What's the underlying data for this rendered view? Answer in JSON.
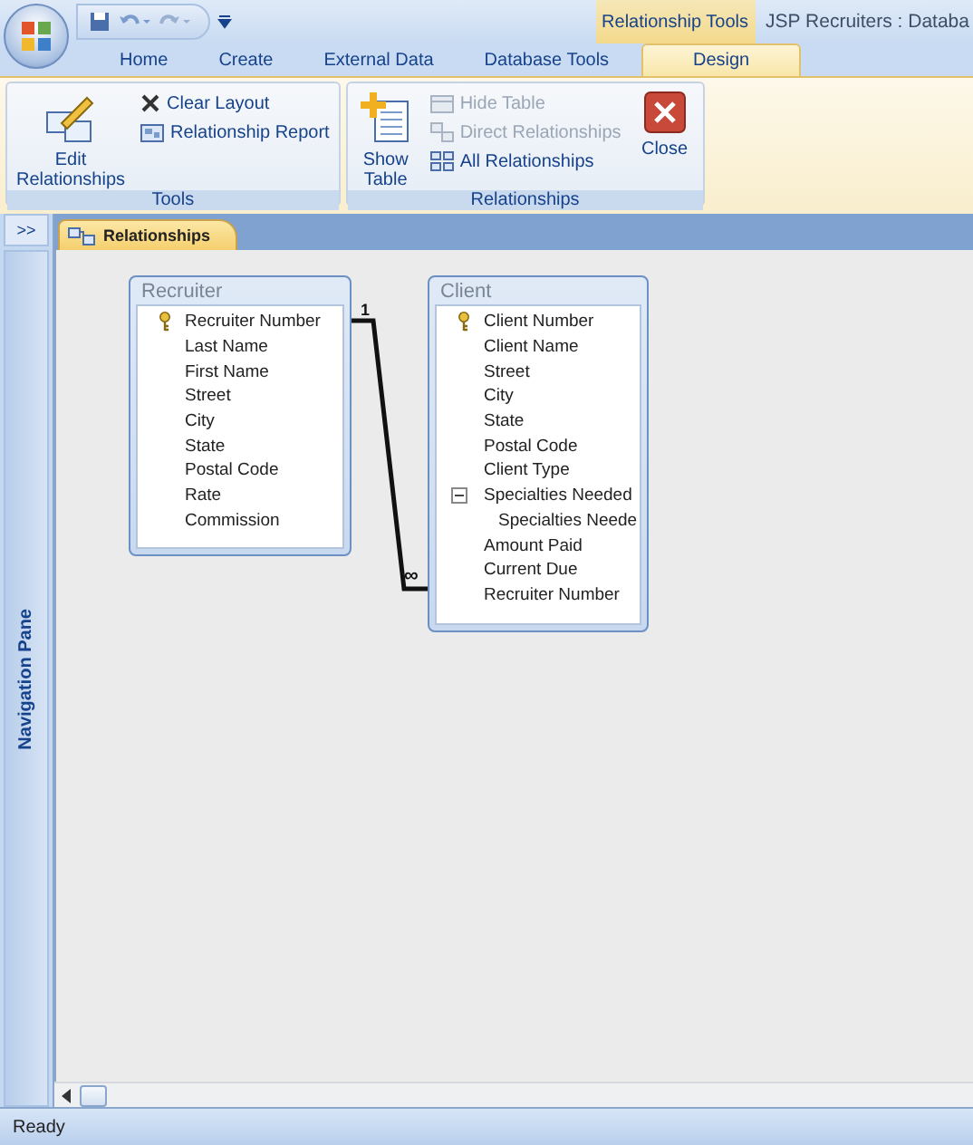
{
  "window": {
    "title": "JSP Recruiters : Databa"
  },
  "contextual_tab": "Relationship Tools",
  "tabs": [
    {
      "label": "Home",
      "selected": false
    },
    {
      "label": "Create",
      "selected": false
    },
    {
      "label": "External Data",
      "selected": false
    },
    {
      "label": "Database Tools",
      "selected": false
    },
    {
      "label": "Design",
      "selected": true
    }
  ],
  "ribbon": [
    {
      "label": "Tools",
      "buttons": [
        {
          "kind": "large",
          "label": "Edit Relationships",
          "disabled": false
        },
        {
          "kind": "small",
          "label": "Clear Layout",
          "disabled": false
        },
        {
          "kind": "small",
          "label": "Relationship Report",
          "disabled": false
        }
      ]
    },
    {
      "label": "Relationships",
      "buttons": [
        {
          "kind": "large",
          "label": "Show Table",
          "disabled": false
        },
        {
          "kind": "small",
          "label": "Hide Table",
          "disabled": true
        },
        {
          "kind": "small",
          "label": "Direct Relationships",
          "disabled": true
        },
        {
          "kind": "small",
          "label": "All Relationships",
          "disabled": false
        },
        {
          "kind": "large",
          "label": "Close",
          "disabled": false
        }
      ]
    }
  ],
  "nav_pane": {
    "toggle": ">>",
    "label": "Navigation Pane"
  },
  "document_tab": {
    "label": "Relationships"
  },
  "tables": [
    {
      "name": "Recruiter",
      "fields": [
        {
          "name": "Recruiter Number",
          "primary_key": true
        },
        {
          "name": "Last Name",
          "primary_key": false
        },
        {
          "name": "First Name",
          "primary_key": false
        },
        {
          "name": "Street",
          "primary_key": false
        },
        {
          "name": "City",
          "primary_key": false
        },
        {
          "name": "State",
          "primary_key": false
        },
        {
          "name": "Postal Code",
          "primary_key": false
        },
        {
          "name": "Rate",
          "primary_key": false
        },
        {
          "name": "Commission",
          "primary_key": false
        }
      ]
    },
    {
      "name": "Client",
      "fields": [
        {
          "name": "Client Number",
          "primary_key": true
        },
        {
          "name": "Client Name",
          "primary_key": false
        },
        {
          "name": "Street",
          "primary_key": false
        },
        {
          "name": "City",
          "primary_key": false
        },
        {
          "name": "State",
          "primary_key": false
        },
        {
          "name": "Postal Code",
          "primary_key": false
        },
        {
          "name": "Client Type",
          "primary_key": false
        },
        {
          "name": "Specialties Needed",
          "primary_key": false,
          "expanded": true,
          "children": [
            {
              "name": "Specialties Neede",
              "primary_key": false
            }
          ]
        },
        {
          "name": "Amount Paid",
          "primary_key": false
        },
        {
          "name": "Current Due",
          "primary_key": false
        },
        {
          "name": "Recruiter Number",
          "primary_key": false
        }
      ]
    }
  ],
  "relationship": {
    "one_side": "1",
    "many_side": "∞"
  },
  "status_bar": {
    "text": "Ready"
  }
}
